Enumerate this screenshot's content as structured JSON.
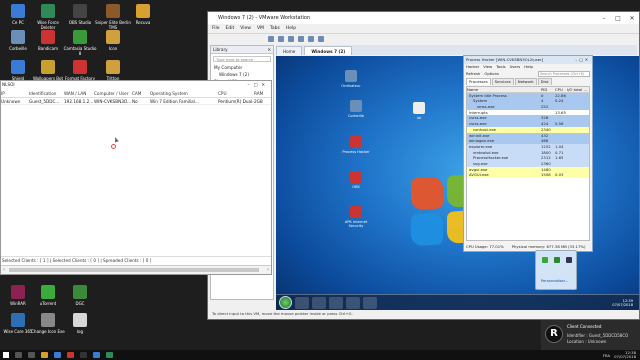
{
  "host_desktop": {
    "icons": [
      {
        "label": "Ce PC",
        "color": "#3a7bd5"
      },
      {
        "label": "Wise Force Deleter",
        "color": "#2e8b57"
      },
      {
        "label": "OBS Studio",
        "color": "#444444"
      },
      {
        "label": "Sniper Elite Berlin TMS",
        "color": "#8b5a2b"
      },
      {
        "label": "Recuva",
        "color": "#d8a030"
      },
      {
        "label": "Corbeille",
        "color": "#6b8fb5"
      },
      {
        "label": "Bandicam",
        "color": "#c33"
      },
      {
        "label": "Camtasia Studio 8",
        "color": "#3a9a3a"
      },
      {
        "label": "Icon",
        "color": "#d0a040"
      },
      {
        "label": "Shield",
        "color": "#3a7bd5"
      },
      {
        "label": "Wallpapers Bot",
        "color": "#c8a030"
      },
      {
        "label": "Format Factory",
        "color": "#c33"
      },
      {
        "label": "Tritton",
        "color": "#d0a040"
      },
      {
        "label": "WinRAR",
        "color": "#8b2252"
      },
      {
        "label": "uTorrent",
        "color": "#3aaa3a"
      },
      {
        "label": "DGC",
        "color": "#3a8a3a"
      },
      {
        "label": "Wise Care 365",
        "color": "#2e6eb5"
      },
      {
        "label": "Change Icon Exe",
        "color": "#888888"
      },
      {
        "label": "log",
        "color": "#d8d8d8"
      }
    ]
  },
  "vmware": {
    "title": "Windows 7 (2) - VMware Workstation",
    "menu": [
      "File",
      "Edit",
      "View",
      "VM",
      "Tabs",
      "Help"
    ],
    "library_title": "Library",
    "library_search": "Type here to search",
    "library_tree": [
      "My Computer",
      "Windows 7 (2)",
      "Shared VMs"
    ],
    "tabs": [
      "Home",
      "Windows 7 (2)"
    ],
    "status": "To direct input to this VM, move the mouse pointer inside or press Ctrl+G."
  },
  "guest": {
    "icons": [
      {
        "label": "Ordinateur",
        "color": "#6a8fb8"
      },
      {
        "label": "Corbeille",
        "color": "#6a8fb8"
      },
      {
        "label": "Process Hacker",
        "color": "#c33"
      },
      {
        "label": "OBS",
        "color": "#c33"
      },
      {
        "label": "APK Internet Security",
        "color": "#c33"
      },
      {
        "label": "lol",
        "color": "#eeeeee"
      }
    ],
    "clock_time": "12:39",
    "clock_date": "07/07/2018"
  },
  "process_hacker": {
    "title": "Process Hacker [WIN-CVKSBN3OL2\\user]",
    "menu": [
      "Hacker",
      "View",
      "Tools",
      "Users",
      "Help"
    ],
    "toolbar": [
      "Refresh",
      "Options"
    ],
    "search_placeholder": "Search Processes (Ctrl+K)",
    "tabs": [
      "Processes",
      "Services",
      "Network",
      "Disk"
    ],
    "columns": [
      "Name",
      "PID",
      "CPU",
      "I/O total ..."
    ],
    "rows": [
      {
        "name": "System Idle Process",
        "pid": "0",
        "cpu": "22.86",
        "io": "",
        "kind": "sys"
      },
      {
        "name": "System",
        "pid": "4",
        "cpu": "0.24",
        "io": "",
        "kind": "sys"
      },
      {
        "name": "smss.exe",
        "pid": "252",
        "cpu": "",
        "io": "",
        "kind": "sys"
      },
      {
        "name": "Interrupts",
        "pid": "",
        "cpu": "13.65",
        "io": "",
        "kind": "plain"
      },
      {
        "name": "csrss.exe",
        "pid": "328",
        "cpu": "",
        "io": "",
        "kind": "sys"
      },
      {
        "name": "csrss.exe",
        "pid": "424",
        "cpu": "0.56",
        "io": "",
        "kind": "sys"
      },
      {
        "name": "conhost.exe",
        "pid": "2340",
        "cpu": "",
        "io": "",
        "kind": "svc"
      },
      {
        "name": "wininit.exe",
        "pid": "432",
        "cpu": "",
        "io": "",
        "kind": "sys"
      },
      {
        "name": "winlogon.exe",
        "pid": "468",
        "cpu": "",
        "io": "",
        "kind": "sys"
      },
      {
        "name": "explorer.exe",
        "pid": "1252",
        "cpu": "1.04",
        "io": "",
        "kind": "own"
      },
      {
        "name": "vmtoolsd.exe",
        "pid": "1800",
        "cpu": "0.71",
        "io": "",
        "kind": "own"
      },
      {
        "name": "ProcessHacker.exe",
        "pid": "2312",
        "cpu": "1.65",
        "io": "",
        "kind": "own"
      },
      {
        "name": "svg.exe",
        "pid": "2360",
        "cpu": "",
        "io": "",
        "kind": "own"
      },
      {
        "name": "avgui.exe",
        "pid": "1480",
        "cpu": "",
        "io": "",
        "kind": "svc"
      },
      {
        "name": "AVGUI.exe",
        "pid": "1508",
        "cpu": "0.03",
        "io": "",
        "kind": "svc"
      }
    ],
    "cpu_usage": "CPU Usage: 77.01%",
    "physical_memory": "Physical memory: 677.38 MB (33.17%)"
  },
  "tray_flyout": {
    "customize": "Personnaliser..."
  },
  "client_manager": {
    "title": "NLSOI",
    "columns": [
      "IP",
      "Identification",
      "WAN / LAN",
      "Computer / User",
      "CAM",
      "Operating System",
      "CPU",
      "RAM"
    ],
    "rows": [
      {
        "ip": "Unknown",
        "id": "Guest_5DDC...",
        "wan": "192.168.1.2...",
        "user": "WIN-CVKSBN3O...",
        "cam": "No",
        "os": "Win 7 Edition Familial...",
        "cpu": "Pentium(R) Dual-Core",
        "ram": "2GB"
      }
    ],
    "status": "Selected Clients : [ 1 ] | Selected Clients : [ 0 ] | Spreaded Clients : [ 0 ]"
  },
  "notification": {
    "logo": "R",
    "title": "Client Connected",
    "line1": "Identifier : Guest_5DDCD58CO",
    "line2": "Location : Unknown"
  },
  "taskbar": {
    "lang": "FRA",
    "time": "12:38",
    "date": "07/07/2018"
  }
}
